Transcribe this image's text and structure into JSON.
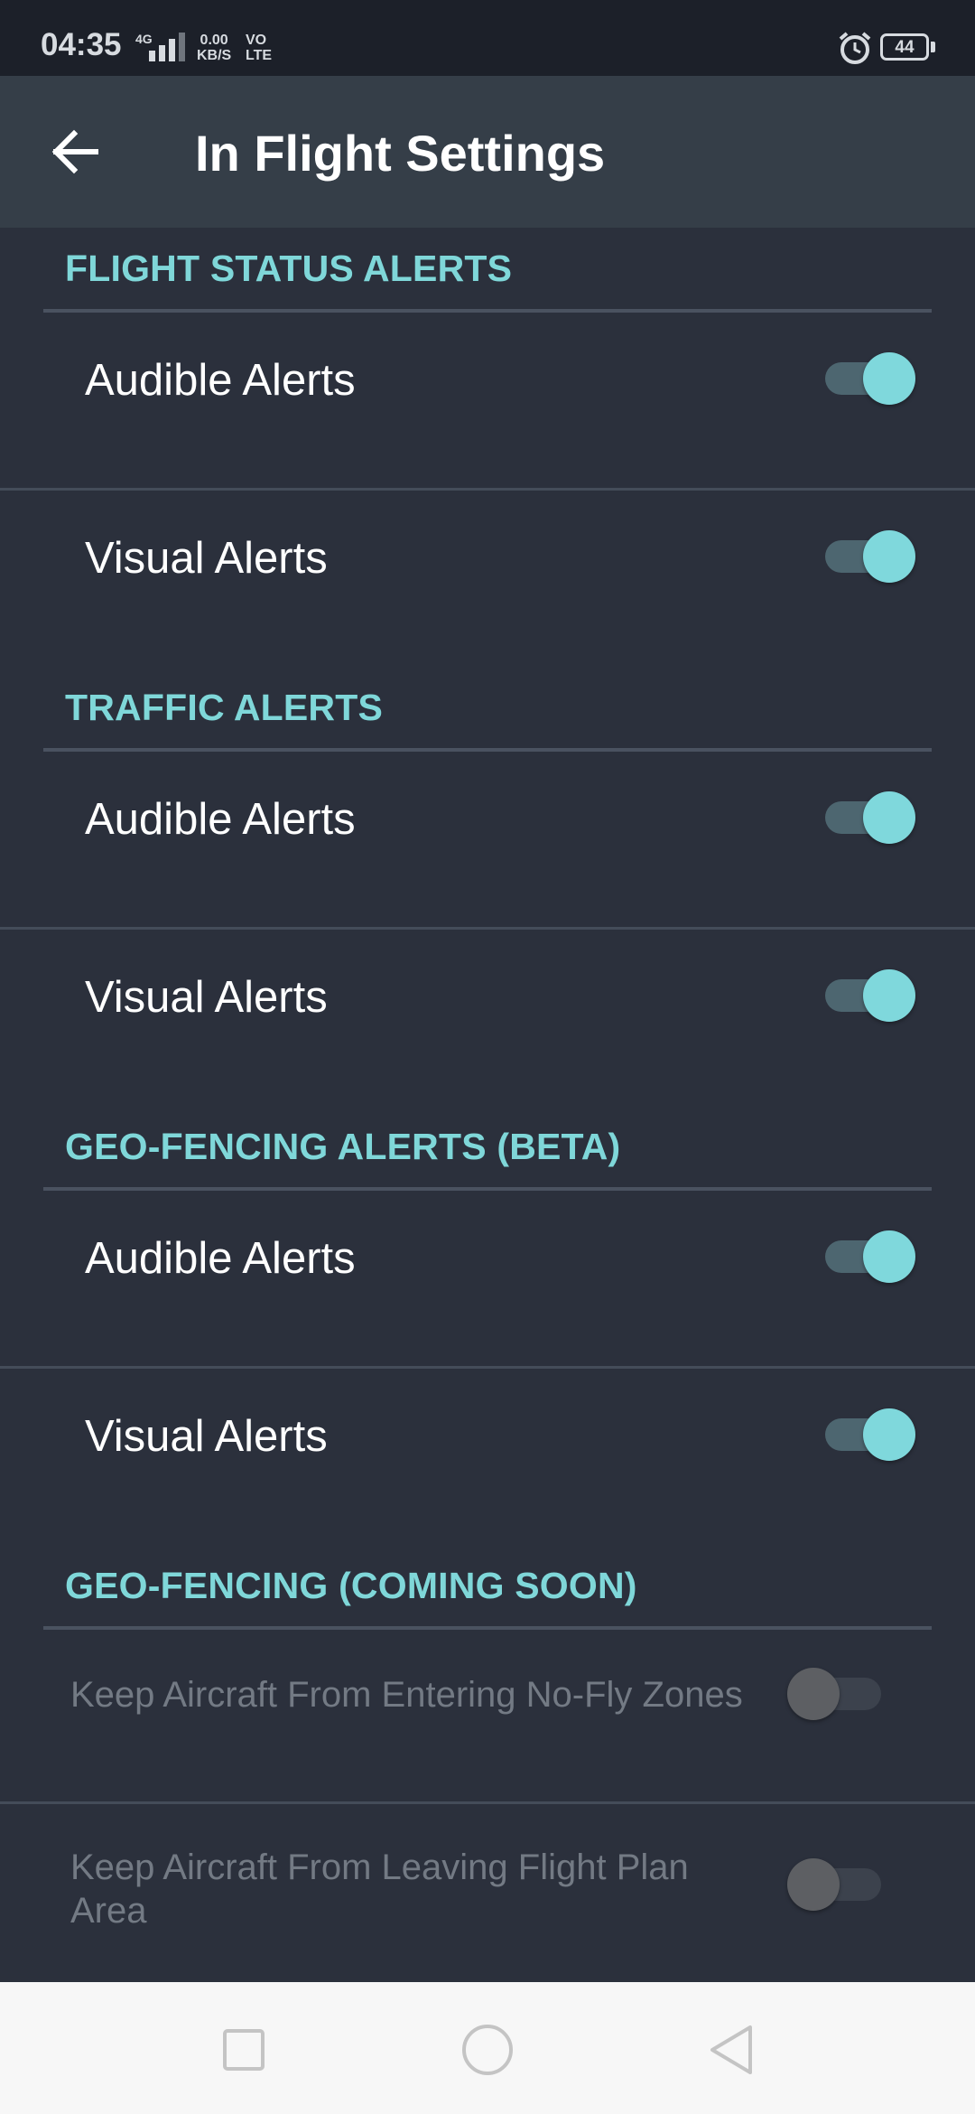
{
  "status_bar": {
    "time": "04:35",
    "network": "4G",
    "speed_value": "0.00",
    "speed_unit": "KB/S",
    "volte_line1": "VO",
    "volte_line2": "LTE",
    "battery": "44"
  },
  "app_bar": {
    "title": "In Flight Settings",
    "back_icon": "arrow-left-icon"
  },
  "sections": [
    {
      "header": "FLIGHT STATUS ALERTS",
      "items": [
        {
          "label": "Audible Alerts",
          "on": true
        },
        {
          "label": "Visual Alerts",
          "on": true
        }
      ]
    },
    {
      "header": "TRAFFIC ALERTS",
      "items": [
        {
          "label": "Audible Alerts",
          "on": true
        },
        {
          "label": "Visual Alerts",
          "on": true
        }
      ]
    },
    {
      "header": "GEO-FENCING ALERTS (BETA)",
      "items": [
        {
          "label": "Audible Alerts",
          "on": true
        },
        {
          "label": "Visual Alerts",
          "on": true
        }
      ]
    },
    {
      "header": "GEO-FENCING (COMING SOON)",
      "items": [
        {
          "label": "Keep Aircraft From Entering No-Fly Zones",
          "on": false,
          "disabled": true
        },
        {
          "label_line1": "Keep Aircraft From Leaving Flight Plan",
          "label_line2": "Area",
          "on": false,
          "disabled": true
        }
      ]
    }
  ],
  "nav_bar": {
    "recents_icon": "square-icon",
    "home_icon": "circle-icon",
    "back_icon": "triangle-back-icon"
  },
  "colors": {
    "accent": "#7fd7d9",
    "background": "#2b303c",
    "app_bar": "#353e48",
    "status_bar": "#1c2029"
  }
}
